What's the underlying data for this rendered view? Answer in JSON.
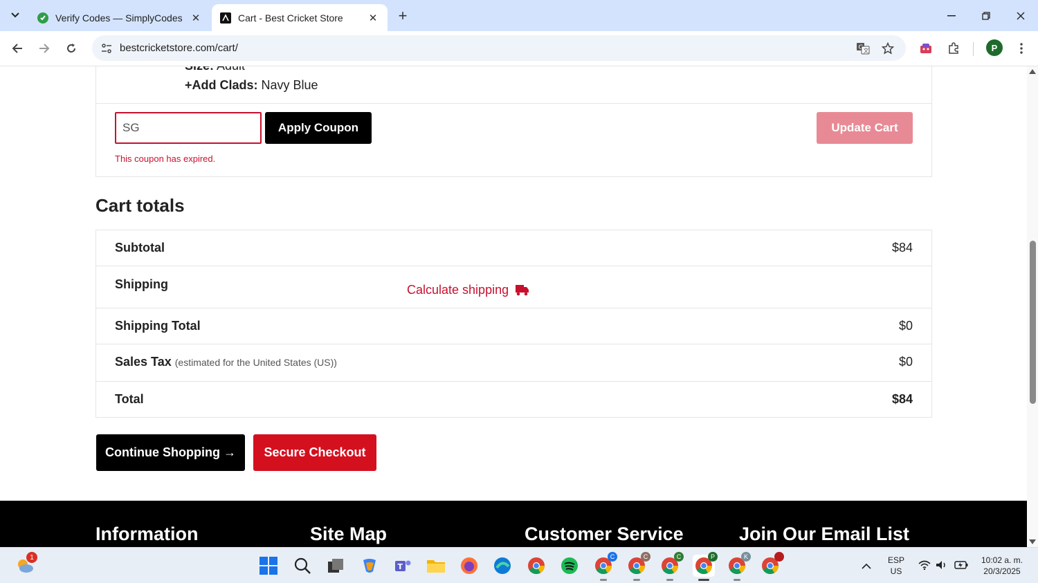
{
  "browser": {
    "tabs": [
      {
        "title": "Verify Codes — SimplyCodes",
        "favicon_color": "#2e9e47",
        "active": false
      },
      {
        "title": "Cart - Best Cricket Store",
        "favicon_color": "#111111",
        "active": true
      }
    ],
    "url": "bestcricketstore.com/cart/",
    "profile_initial": "P"
  },
  "item_meta": {
    "size_label": "Size:",
    "size_value": "Adult",
    "clads_label": "+Add Clads:",
    "clads_value": "Navy Blue"
  },
  "coupon": {
    "value": "SG",
    "apply_label": "Apply Coupon",
    "error": "This coupon has expired.",
    "update_label": "Update Cart"
  },
  "cart_totals": {
    "title": "Cart totals",
    "rows": [
      {
        "label": "Subtotal",
        "value": "$84"
      },
      {
        "label": "Shipping",
        "link": "Calculate shipping"
      },
      {
        "label": "Shipping Total",
        "value": "$0"
      },
      {
        "label": "Sales Tax",
        "note": "(estimated for the United States (US))",
        "value": "$0"
      },
      {
        "label": "Total",
        "value": "$84"
      }
    ]
  },
  "actions": {
    "continue_label": "Continue Shopping →",
    "checkout_label": "Secure Checkout"
  },
  "footer": {
    "headings": [
      "Information",
      "Site Map",
      "Customer Service",
      "Join Our Email List"
    ]
  },
  "taskbar": {
    "weather_badge": "1",
    "lang": "ESP",
    "region": "US",
    "time": "10:02 a. m.",
    "date": "20/3/2025",
    "chrome_profiles": [
      "C",
      "C",
      "C",
      "P",
      "K"
    ]
  },
  "colors": {
    "accent_red": "#c8102e",
    "checkout_red": "#d4101f",
    "update_pink": "#e88a95",
    "tabbar_blue": "#d3e3fd"
  }
}
